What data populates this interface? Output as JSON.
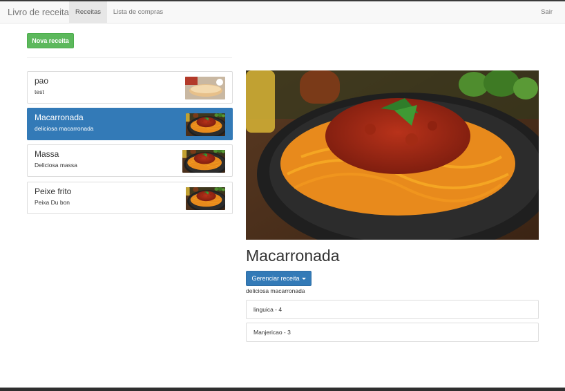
{
  "navbar": {
    "brand": "Livro de receita",
    "tabs": [
      {
        "label": "Receitas",
        "active": true
      },
      {
        "label": "Lista de compras",
        "active": false
      }
    ],
    "logout": "Sair"
  },
  "actions": {
    "new_recipe": "Nova receita"
  },
  "recipes": [
    {
      "name": "pao",
      "description": "test",
      "image": "bread-image"
    },
    {
      "name": "Macarronada",
      "description": "deliciosa macarronada",
      "image": "spaghetti-image",
      "active": true
    },
    {
      "name": "Massa",
      "description": "Deliciosa massa",
      "image": "spaghetti-image"
    },
    {
      "name": "Peixe frito",
      "description": "Peixa Du bon",
      "image": "spaghetti-image"
    }
  ],
  "detail": {
    "title": "Macarronada",
    "manage_label": "Gerenciar receita",
    "description": "deliciosa macarronada",
    "image": "spaghetti-image",
    "ingredients": [
      "linguica - 4",
      "Manjericao - 3"
    ]
  },
  "colors": {
    "success": "#5cb85c",
    "primary": "#337ab7",
    "navbar_bg": "#f8f8f8"
  }
}
